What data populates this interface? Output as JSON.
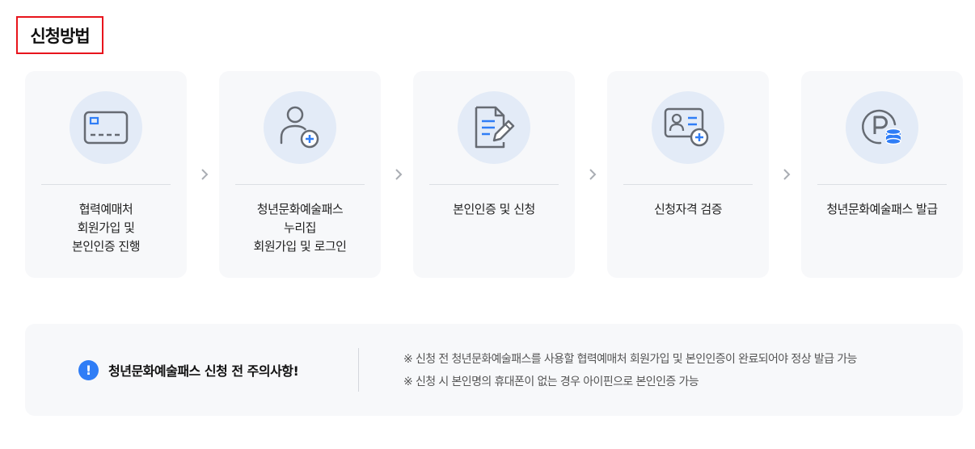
{
  "section": {
    "title": "신청방법"
  },
  "steps": [
    {
      "icon": "credit-card-icon",
      "label": "협력예매처\n회원가입 및\n본인인증 진행"
    },
    {
      "icon": "user-add-icon",
      "label": "청년문화예술패스\n누리집\n회원가입 및 로그인"
    },
    {
      "icon": "document-edit-icon",
      "label": "본인인증 및 신청"
    },
    {
      "icon": "id-card-add-icon",
      "label": "신청자격 검증"
    },
    {
      "icon": "points-coin-icon",
      "label": "청년문화예술패스 발급"
    }
  ],
  "notice": {
    "badge": "!",
    "title": "청년문화예술패스 신청 전 주의사항!",
    "lines": [
      "※ 신청 전 청년문화예술패스를 사용할 협력예매처 회원가입 및 본인인증이 완료되어야 정상 발급 가능",
      "※ 신청 시 본인명의 휴대폰이 없는 경우 아이핀으로 본인인증 가능"
    ]
  },
  "colors": {
    "accent_red": "#e8141c",
    "accent_blue": "#2f7df6",
    "icon_gray": "#666b73",
    "icon_circle": "#e3ebf7",
    "card_bg": "#f7f8fa"
  }
}
